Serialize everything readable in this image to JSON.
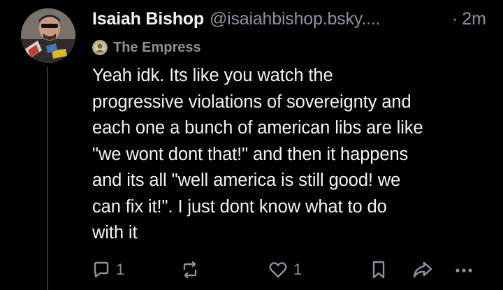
{
  "post": {
    "author": {
      "display_name": "Isaiah Bishop",
      "handle": "@isaiahbishop.bsky....",
      "separator": "·",
      "timestamp": "2m"
    },
    "label": {
      "text": "The Empress",
      "icon": "empress-badge-icon"
    },
    "text": "Yeah idk. Its like you watch the\nprogressive violations of sovereignty and\neach one a bunch of american libs are like\n\"we wont dont that!\" and then it happens\nand its all \"well america is still good! we\ncan fix it!\". I just dont know what to do\nwith it",
    "actions": {
      "reply_count": "1",
      "like_count": "1",
      "icons": [
        "reply-icon",
        "repost-icon",
        "like-icon",
        "bookmark-icon",
        "share-icon",
        "more-icon"
      ]
    }
  },
  "colors": {
    "background": "#000000",
    "text_primary": "#f1f3f5",
    "text_secondary": "#8a949e",
    "thread_line": "#2e3438"
  }
}
